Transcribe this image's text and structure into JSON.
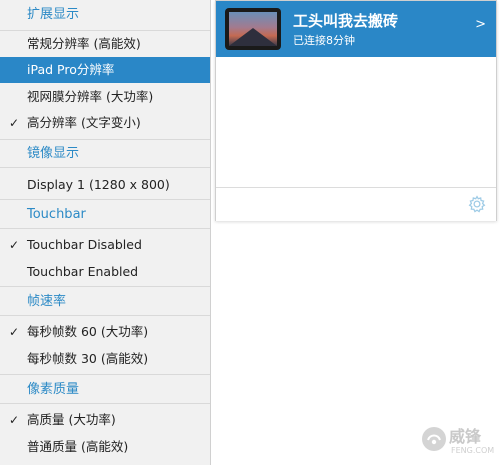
{
  "menu": {
    "items": [
      {
        "type": "header",
        "label": "扩展显示"
      },
      {
        "type": "item",
        "label": "常规分辨率 (高能效)",
        "checked": false,
        "selected": false
      },
      {
        "type": "item",
        "label": "iPad Pro分辨率",
        "checked": false,
        "selected": true
      },
      {
        "type": "item",
        "label": "视网膜分辨率 (大功率)",
        "checked": false,
        "selected": false
      },
      {
        "type": "item",
        "label": "高分辨率 (文字变小)",
        "checked": true,
        "selected": false
      },
      {
        "type": "header",
        "label": "镜像显示"
      },
      {
        "type": "item",
        "label": "Display 1 (1280 x 800)",
        "checked": false,
        "selected": false
      },
      {
        "type": "header",
        "label": "Touchbar"
      },
      {
        "type": "item",
        "label": "Touchbar Disabled",
        "checked": true,
        "selected": false
      },
      {
        "type": "item",
        "label": "Touchbar Enabled",
        "checked": false,
        "selected": false
      },
      {
        "type": "header",
        "label": "帧速率"
      },
      {
        "type": "item",
        "label": "每秒帧数 60 (大功率)",
        "checked": true,
        "selected": false
      },
      {
        "type": "item",
        "label": "每秒帧数 30 (高能效)",
        "checked": false,
        "selected": false
      },
      {
        "type": "header",
        "label": "像素质量"
      },
      {
        "type": "item",
        "label": "高质量 (大功率)",
        "checked": true,
        "selected": false
      },
      {
        "type": "item",
        "label": "普通质量 (高能效)",
        "checked": false,
        "selected": false
      }
    ],
    "check_glyph": "✓"
  },
  "device": {
    "name": "工头叫我去搬砖",
    "status": "已连接8分钟",
    "chevron": ">"
  },
  "footer": {
    "settings_icon": "gear-icon"
  },
  "watermark": {
    "text": "威锋",
    "sub": "FENG.COM"
  },
  "colors": {
    "accent": "#2a87c7",
    "header_text": "#2c8ac6",
    "menu_bg": "#f1f1f1"
  }
}
